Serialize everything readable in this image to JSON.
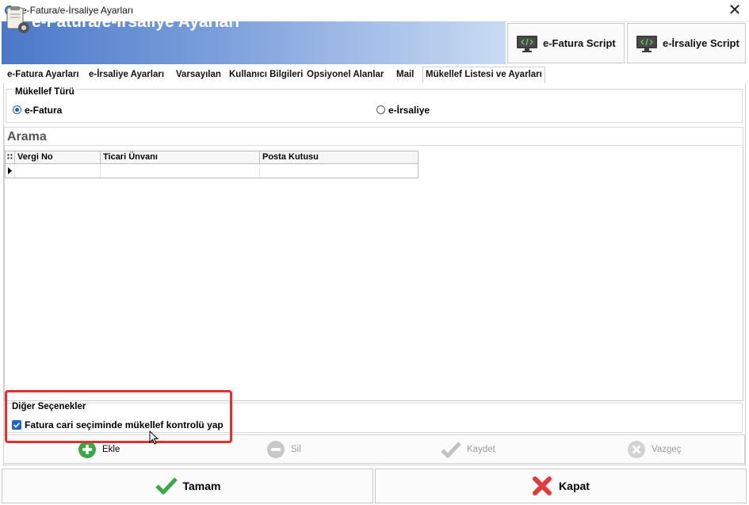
{
  "window": {
    "title": "e-Fatura/e-İrsaliye Ayarları",
    "close_glyph": "✕"
  },
  "banner": {
    "title": "e-Fatura/e-İrsaliye Ayarları"
  },
  "script_buttons": {
    "efatura": "e-Fatura Script",
    "eirsaliye": "e-İrsaliye Script"
  },
  "tabs": [
    {
      "label": "e-Fatura Ayarları"
    },
    {
      "label": "e-İrsaliye Ayarları"
    },
    {
      "label": "Varsayılan"
    },
    {
      "label": "Kullanıcı Bilgileri"
    },
    {
      "label": "Opsiyonel Alanlar"
    },
    {
      "label": "Mail"
    },
    {
      "label": "Mükellef Listesi ve Ayarları",
      "active": true
    }
  ],
  "mukellef_turu": {
    "label": "Mükellef Türü",
    "options": [
      {
        "label": "e-Fatura",
        "selected": true
      },
      {
        "label": "e-İrsaliye",
        "selected": false
      }
    ]
  },
  "arama": {
    "title": "Arama"
  },
  "grid": {
    "columns": [
      "Vergi No",
      "Ticari Ünvanı",
      "Posta Kutusu"
    ],
    "rows": []
  },
  "diger": {
    "label": "Diğer Seçenekler",
    "checkbox_label": "Fatura cari seçiminde mükellef kontrolü yap",
    "checked": true
  },
  "actions": {
    "ekle": "Ekle",
    "sil": "Sil",
    "kaydet": "Kaydet",
    "vazgec": "Vazgeç"
  },
  "footer": {
    "tamam": "Tamam",
    "kapat": "Kapat"
  },
  "colors": {
    "banner_start": "#4a78c9",
    "highlight": "#e03131",
    "accent": "#1b66c9"
  }
}
